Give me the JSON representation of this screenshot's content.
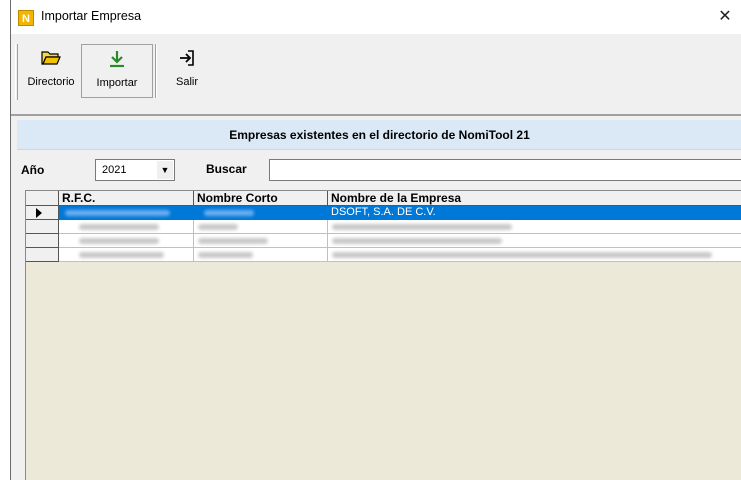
{
  "window": {
    "title": "Importar Empresa",
    "app_icon_letter": "N",
    "close_glyph": "✕"
  },
  "toolbar": {
    "items": [
      {
        "label": "Directorio",
        "icon": "folder-open-icon"
      },
      {
        "label": "Importar",
        "icon": "download-arrow-icon"
      },
      {
        "label": "Salir",
        "icon": "exit-icon"
      }
    ]
  },
  "banner": {
    "text": "Empresas existentes en el directorio de NomiTool 21"
  },
  "filter": {
    "year_label": "Año",
    "year_value": "2021",
    "search_label": "Buscar",
    "search_value": ""
  },
  "grid": {
    "columns": [
      "R.F.C.",
      "Nombre Corto",
      "Nombre de la Empresa"
    ],
    "rows": [
      {
        "rfc": "",
        "nombre_corto": "",
        "nombre_empresa": "DSOFT, S.A. DE C.V.",
        "selected": true
      },
      {
        "rfc": "",
        "nombre_corto": "",
        "nombre_empresa": "",
        "selected": false
      },
      {
        "rfc": "",
        "nombre_corto": "",
        "nombre_empresa": "",
        "selected": false
      },
      {
        "rfc": "",
        "nombre_corto": "",
        "nombre_empresa": "",
        "selected": false
      }
    ]
  },
  "colors": {
    "selection": "#0078d7",
    "banner": "#dbe9f7",
    "grid_background": "#ece9d8",
    "importar_icon": "#2a8a2a",
    "directorio_icon": "#f2c200"
  }
}
